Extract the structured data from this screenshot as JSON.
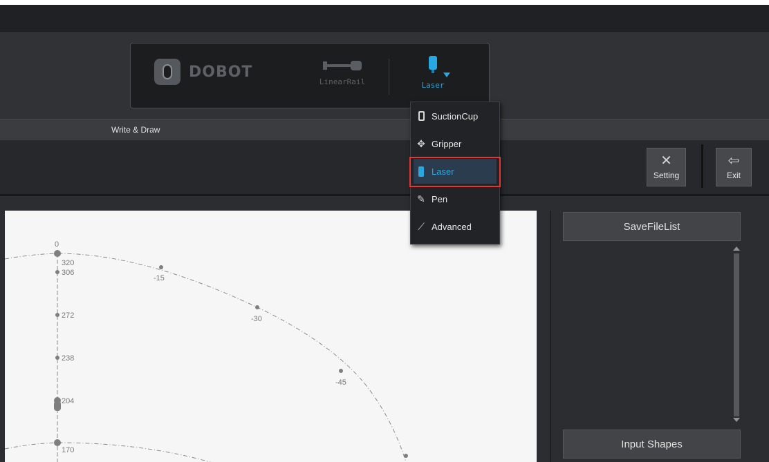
{
  "header": {
    "brand": "DOBOT",
    "tools": [
      {
        "label": "LinearRail",
        "icon": "linear-rail-icon"
      },
      {
        "label": "Laser",
        "icon": "laser-icon"
      }
    ]
  },
  "section": {
    "title": "Write & Draw"
  },
  "toolbar": {
    "setting_label": "Setting",
    "exit_label": "Exit"
  },
  "dropdown": {
    "items": [
      {
        "label": "SuctionCup",
        "icon": "suction-cup-icon",
        "selected": false
      },
      {
        "label": "Gripper",
        "icon": "gripper-icon",
        "selected": false
      },
      {
        "label": "Laser",
        "icon": "laser-icon",
        "selected": true
      },
      {
        "label": "Pen",
        "icon": "pen-icon",
        "selected": false
      },
      {
        "label": "Advanced",
        "icon": "advanced-icon",
        "selected": false
      }
    ]
  },
  "sidepanel": {
    "save_list_label": "SaveFileList",
    "input_shapes_label": "Input Shapes"
  },
  "canvas": {
    "angle_labels": [
      "0",
      "-15",
      "-30",
      "-45"
    ],
    "radius_labels": [
      "320",
      "306",
      "272",
      "238",
      "204",
      "170"
    ]
  },
  "colors": {
    "accent": "#27a8e0",
    "highlight": "#e53535",
    "background": "#2b2d30"
  }
}
